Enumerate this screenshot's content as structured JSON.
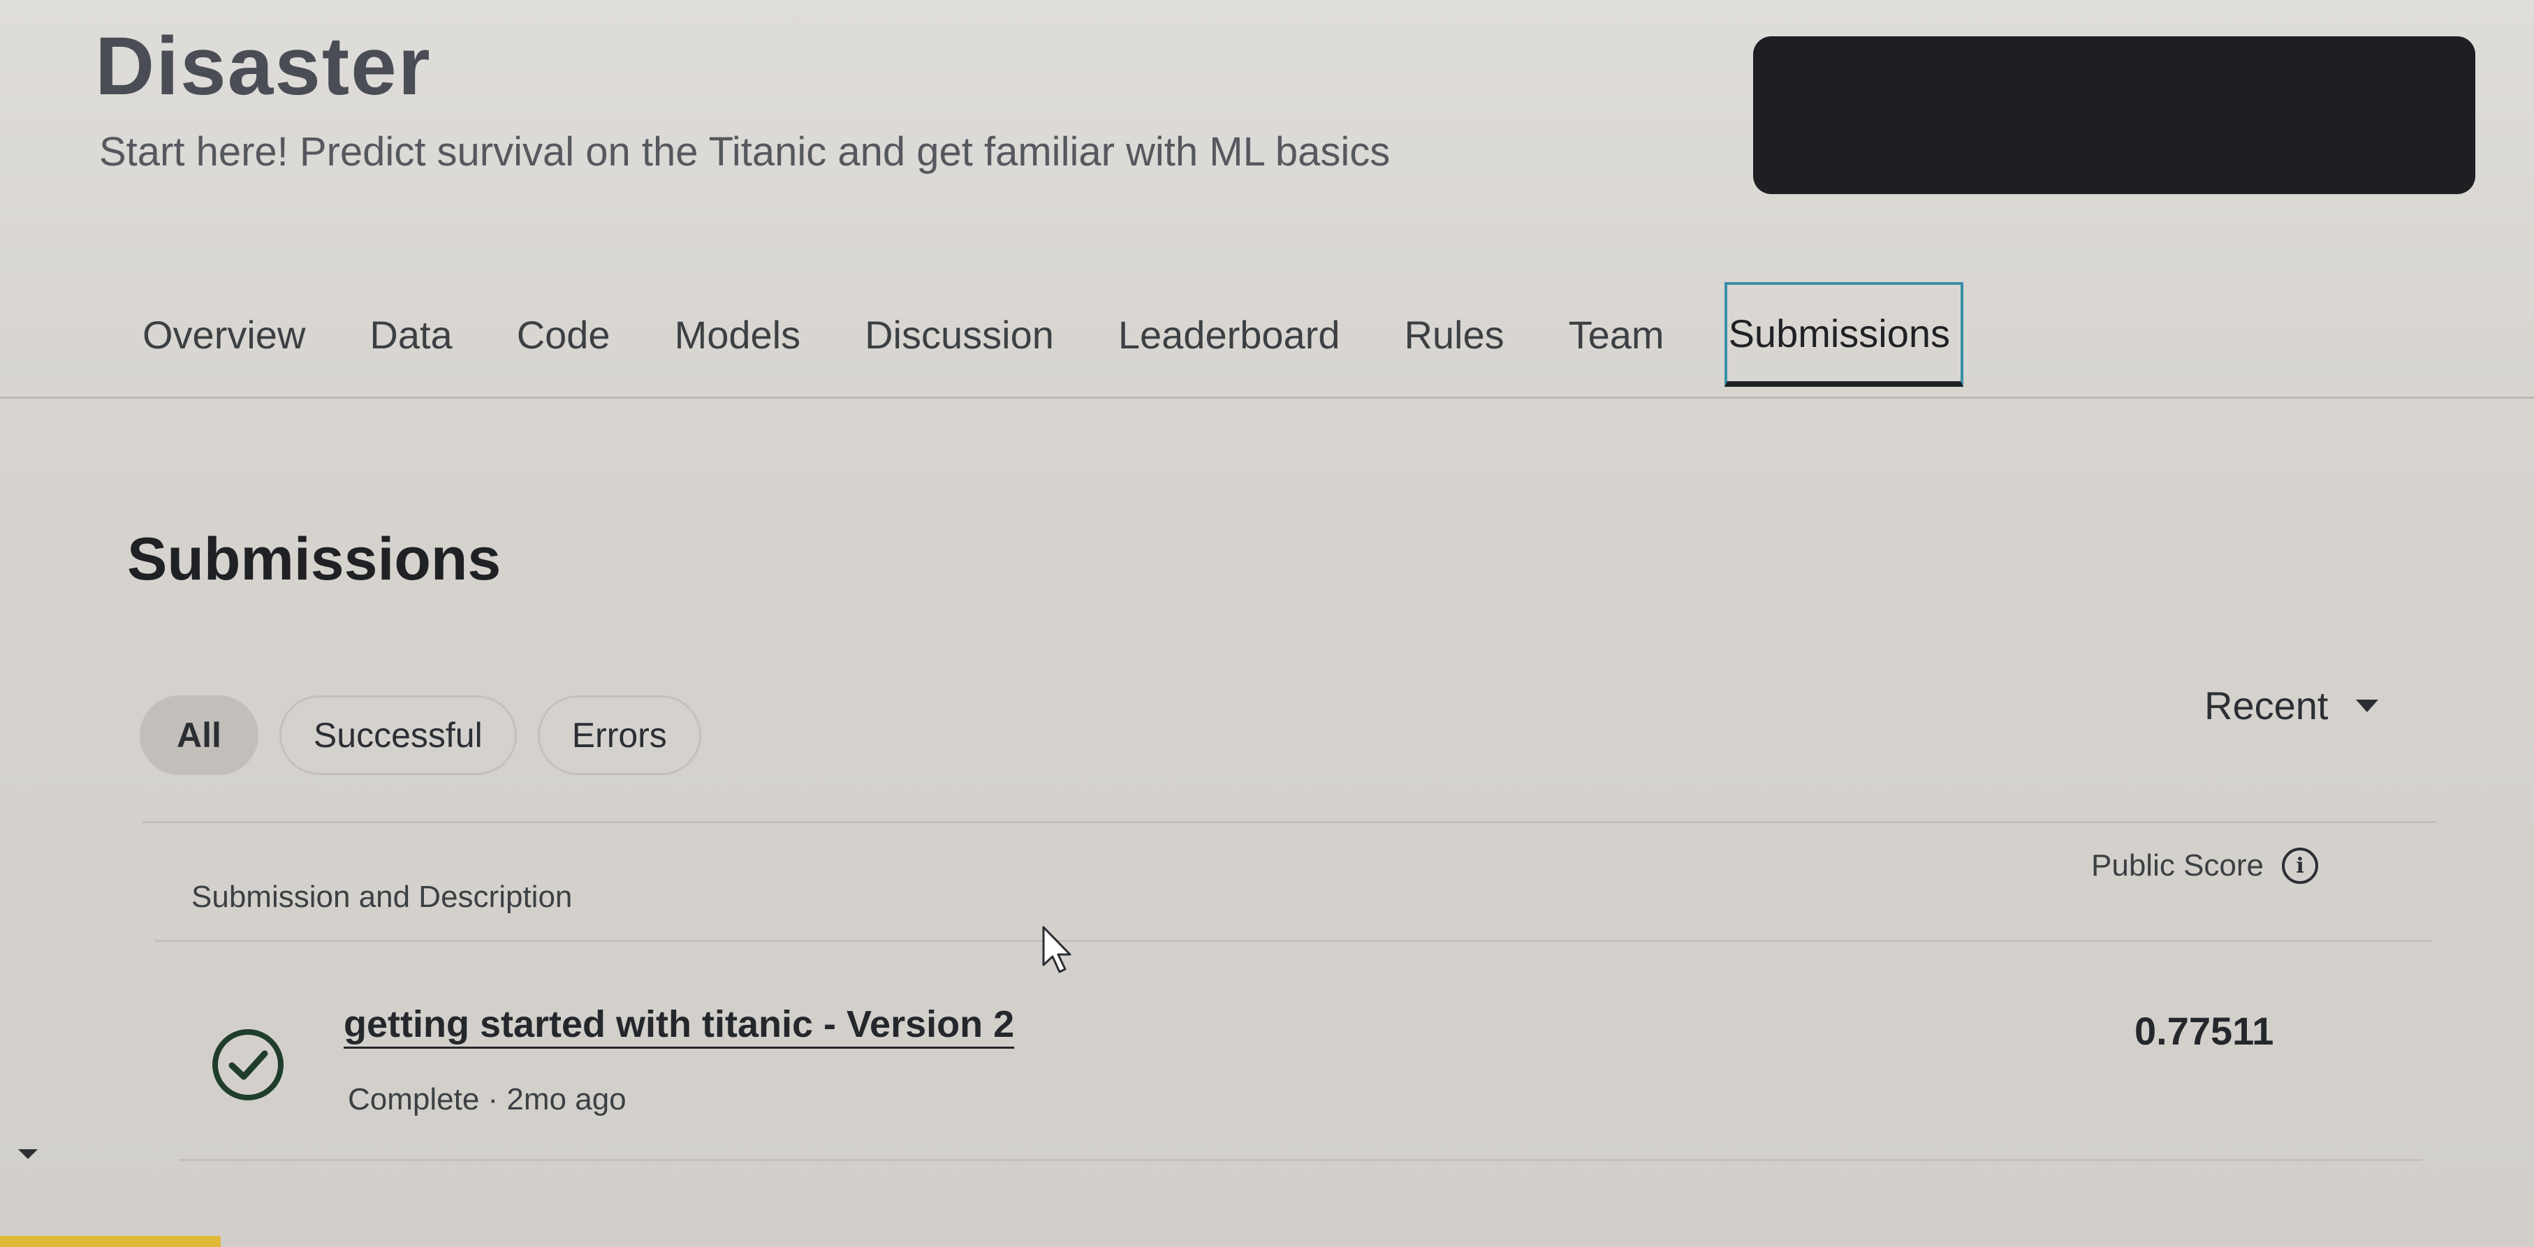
{
  "header": {
    "title": "Disaster",
    "subtitle": "Start here! Predict survival on the Titanic and get familiar with ML basics"
  },
  "tabs": [
    {
      "label": "Overview"
    },
    {
      "label": "Data"
    },
    {
      "label": "Code"
    },
    {
      "label": "Models"
    },
    {
      "label": "Discussion"
    },
    {
      "label": "Leaderboard"
    },
    {
      "label": "Rules"
    },
    {
      "label": "Team"
    },
    {
      "label": "Submissions",
      "active": true
    }
  ],
  "main": {
    "section_title": "Submissions",
    "filters": [
      {
        "label": "All",
        "active": true
      },
      {
        "label": "Successful"
      },
      {
        "label": "Errors"
      }
    ],
    "sort": {
      "label": "Recent",
      "icon": "caret-down-icon"
    },
    "columns": {
      "left": "Submission and Description",
      "right": "Public Score",
      "right_icon": "info-icon",
      "info_glyph": "i"
    },
    "submissions": [
      {
        "name": "getting started with titanic - Version 2",
        "meta": "Complete · 2mo ago",
        "status_icon": "check-circle-icon",
        "score": "0.77511"
      }
    ]
  },
  "colors": {
    "active_tab_outline": "#3a8fa8",
    "redacted_block": "#1d1f23",
    "bottom_accent": "#e0b83a"
  }
}
